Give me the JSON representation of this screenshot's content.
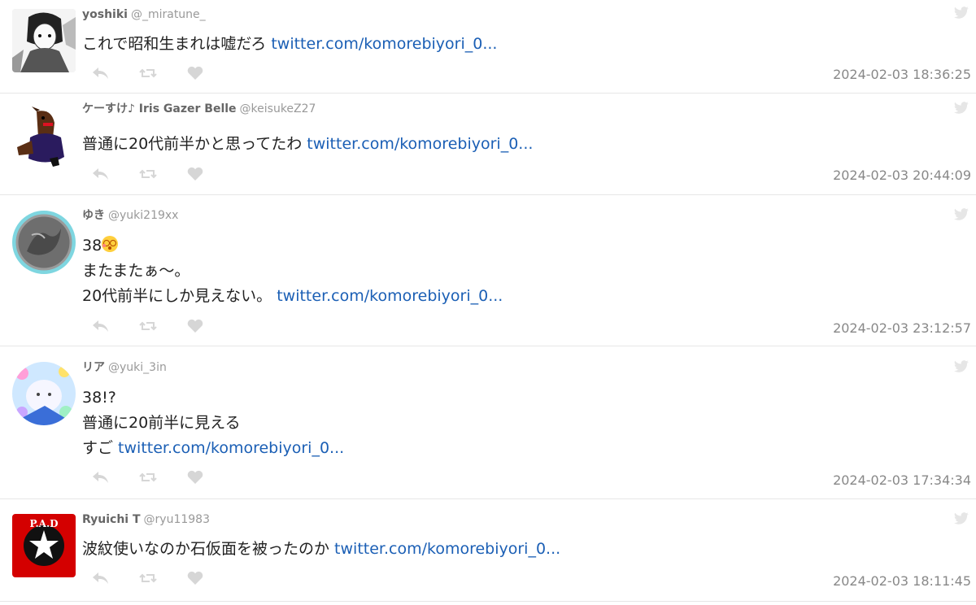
{
  "tweets": [
    {
      "name": "yoshiki",
      "handle": "@_miratune_",
      "lines": [
        "これで昭和生まれは嘘だろ "
      ],
      "link": "twitter.com/komorebiyori_0...",
      "timestamp": "2024-02-03 18:36:25",
      "avatar": "manga-avatar"
    },
    {
      "name": "ケーすけ♪ Iris Gazer Belle",
      "handle": "@keisukeZ27",
      "lines": [
        "普通に20代前半かと思ってたわ "
      ],
      "link": "twitter.com/komorebiyori_0...",
      "timestamp": "2024-02-03 20:44:09",
      "avatar": "horse-plush-avatar"
    },
    {
      "name": "ゆき",
      "handle": "@yuki219xx",
      "lines": [
        "38",
        "またまたぁ〜。",
        "20代前半にしか見えない。 "
      ],
      "link": "twitter.com/komorebiyori_0...",
      "timestamp": "2024-02-03 23:12:57",
      "avatar": "coin-avatar"
    },
    {
      "name": "リア",
      "handle": "@yuki_3in",
      "lines": [
        "38!?",
        "普通に20前半に見える",
        "すご "
      ],
      "link": "twitter.com/komorebiyori_0...",
      "timestamp": "2024-02-03 17:34:34",
      "avatar": "flower-avatar"
    },
    {
      "name": "Ryuichi T",
      "handle": "@ryu11983",
      "lines": [
        "波紋使いなのか石仮面を被ったのか "
      ],
      "link": "twitter.com/komorebiyori_0...",
      "timestamp": "2024-02-03 18:11:45",
      "avatar": "pad-logo-avatar"
    }
  ],
  "colors": {
    "link": "#1b5fb5",
    "icon": "#d3d3d3",
    "timestamp": "#888888"
  },
  "icons": [
    "reply-icon",
    "retweet-icon",
    "like-icon",
    "twitter-bird-icon",
    "flushed-face-emoji"
  ]
}
